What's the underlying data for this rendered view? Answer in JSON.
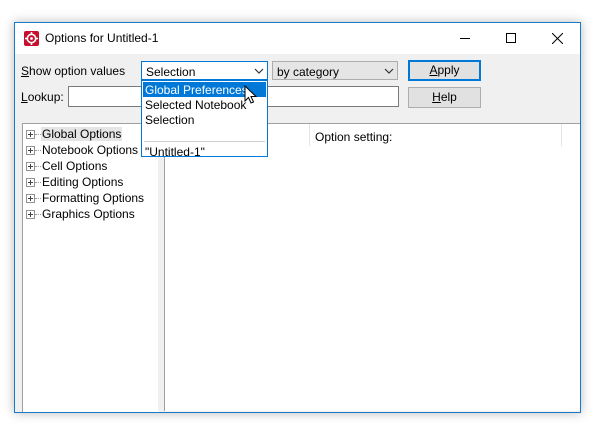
{
  "window": {
    "title": "Options for Untitled-1"
  },
  "toolbar": {
    "show_label_prefix": "S",
    "show_label_rest": "how option values",
    "show_combo_value": "Selection",
    "category_combo_value": "by category",
    "apply_label_prefix": "A",
    "apply_label_rest": "pply",
    "lookup_label_prefix": "L",
    "lookup_label_rest": "ookup:",
    "lookup_value": "",
    "help_label_prefix": "H",
    "help_label_rest": "elp"
  },
  "dropdown": {
    "options": [
      {
        "label": "Global Preferences",
        "highlighted": true
      },
      {
        "label": "Selected Notebook"
      },
      {
        "label": "Selection"
      },
      {
        "label": "\"Untitled-1\""
      }
    ]
  },
  "tree": {
    "items": [
      {
        "label": "Global Options",
        "selected": true
      },
      {
        "label": "Notebook Options"
      },
      {
        "label": "Cell Options"
      },
      {
        "label": "Editing Options"
      },
      {
        "label": "Formatting Options"
      },
      {
        "label": "Graphics Options"
      }
    ]
  },
  "table": {
    "headers": [
      "",
      "Option setting:"
    ]
  },
  "colors": {
    "accent": "#0078d7",
    "icon_red": "#c8102e"
  }
}
